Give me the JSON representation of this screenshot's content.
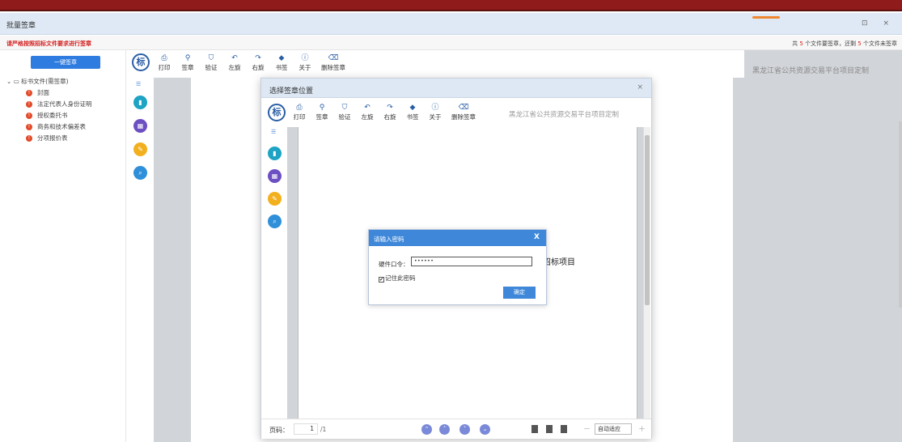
{
  "app": {
    "title": "批量签章",
    "window_buttons": "⊡ ×",
    "notice_left": "请严格按照招标文件要求进行签章",
    "notice_right": {
      "prefix": "共",
      "total": "5",
      "mid": "个文件要签章，还剩",
      "remain": "5",
      "suffix": "个文件未签章"
    }
  },
  "sidebar": {
    "one_key_sign": "一键签章",
    "root": "标书文件(需签章)",
    "items": [
      {
        "label": "封面"
      },
      {
        "label": "法定代表人身份证明"
      },
      {
        "label": "授权委托书"
      },
      {
        "label": "商务和技术偏差表"
      },
      {
        "label": "分项报价表"
      }
    ]
  },
  "toolbar": {
    "logo": "标",
    "buttons": [
      {
        "label": "打印",
        "icon": "printer-icon",
        "glyph": "⎙"
      },
      {
        "label": "签章",
        "icon": "stamp-icon",
        "glyph": "⚲"
      },
      {
        "label": "验证",
        "icon": "shield-check-icon",
        "glyph": "⛉"
      },
      {
        "label": "左旋",
        "icon": "rotate-left-icon",
        "glyph": "↶"
      },
      {
        "label": "右旋",
        "icon": "rotate-right-icon",
        "glyph": "↷"
      },
      {
        "label": "书签",
        "icon": "bookmark-tag-icon",
        "glyph": "◆"
      },
      {
        "label": "关于",
        "icon": "info-icon",
        "glyph": "ⓘ"
      },
      {
        "label": "删除签章",
        "icon": "trash-icon",
        "glyph": "⌫"
      }
    ],
    "brand": "黑龙江省公共资源交易平台项目定制"
  },
  "dialog": {
    "title": "选择签章位置",
    "close": "×",
    "page_title_text": "（项目名称）设备采购招标项目",
    "footer": {
      "page_label": "页码：",
      "page_value": "1",
      "total": "/1",
      "zoom": "自动适应",
      "minus": "－",
      "plus": "＋"
    }
  },
  "password": {
    "title": "请输入密码",
    "close": "X",
    "label": "硬件口令：",
    "value": "••••••",
    "remember": "记住此密码",
    "remember_checked": "✔",
    "ok": "确定"
  },
  "colors": {
    "header_red": "#8f1b1b",
    "accent_blue": "#3f88d9",
    "warn_red": "#e14b2a"
  }
}
